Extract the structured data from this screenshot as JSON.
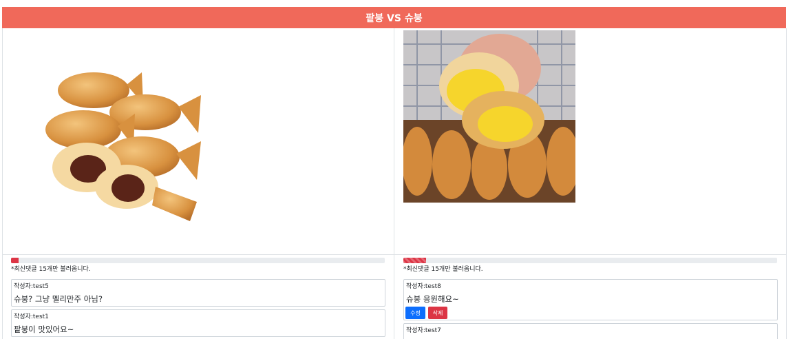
{
  "header": {
    "title": "팥붕 VS 슈붕"
  },
  "left": {
    "image_alt": "팥붕",
    "progress_percent": 2,
    "note": "*최신댓글 15개만 불러옵니다.",
    "comments": [
      {
        "author": "작성자:test5",
        "text": "슈붕? 그냥 멜리만주 아님?"
      },
      {
        "author": "작성자:test1",
        "text": "팥붕이 맛있어요~"
      }
    ]
  },
  "right": {
    "image_alt": "슈붕",
    "progress_percent": 6,
    "note": "*최신댓글 15개만 불러옵니다.",
    "comments": [
      {
        "author": "작성자:test8",
        "text": "슈붕 응원해요~",
        "edit_label": "수정",
        "delete_label": "삭제"
      },
      {
        "author": "작성자:test7",
        "text": ""
      }
    ]
  },
  "colors": {
    "accent": "#f0695a",
    "progress": "#dc3545",
    "edit": "#0d6efd",
    "delete": "#dc3545"
  }
}
